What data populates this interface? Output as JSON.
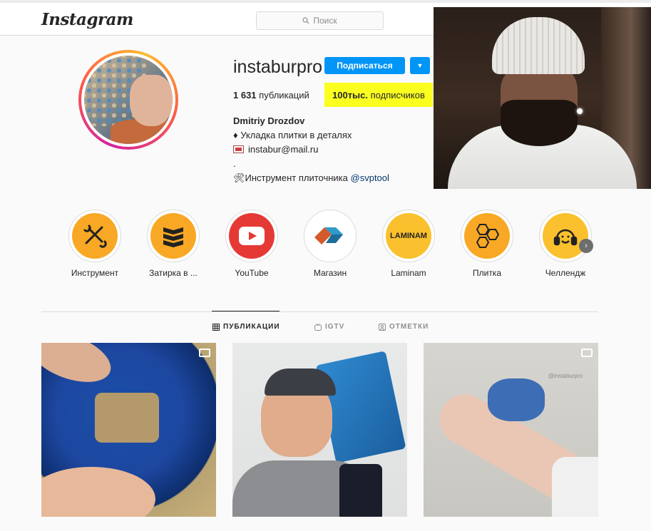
{
  "header": {
    "logo": "Instagram",
    "search_placeholder": "Поиск"
  },
  "profile": {
    "username": "instaburpro",
    "follow_label": "Подписаться",
    "posts_count": "1 631",
    "posts_label": "публикаций",
    "followers_count": "100тыс.",
    "followers_label": "подписчиков",
    "name": "Dmitriy Drozdov",
    "bio_line1": "♦ Укладка плитки в деталях",
    "bio_email": "instabur@mail.ru",
    "bio_dot": ".",
    "bio_tool_prefix": "🛠Инструмент плиточника",
    "bio_tool_link": "@svptool"
  },
  "highlights": [
    {
      "label": "Инструмент",
      "icon": "tools-icon",
      "bg": "#f9a825"
    },
    {
      "label": "Затирка в ...",
      "icon": "grout-layers-icon",
      "bg": "#f9a825"
    },
    {
      "label": "YouTube",
      "icon": "youtube-icon",
      "bg": "#e53935"
    },
    {
      "label": "Магазин",
      "icon": "shop-logo-icon",
      "bg": "#ffffff"
    },
    {
      "label": "Laminam",
      "icon": "laminam-logo-icon",
      "bg": "#fbc02d",
      "text": "LAMINAM"
    },
    {
      "label": "Плитка",
      "icon": "hexagon-tiles-icon",
      "bg": "#f9a825"
    },
    {
      "label": "Челлендж",
      "icon": "headphones-face-icon",
      "bg": "#fbc02d"
    }
  ],
  "tabs": [
    {
      "label": "ПУБЛИКАЦИИ",
      "icon": "grid-icon",
      "active": true
    },
    {
      "label": "IGTV",
      "icon": "igtv-icon",
      "active": false
    },
    {
      "label": "ОТМЕТКИ",
      "icon": "tagged-icon",
      "active": false
    }
  ],
  "posts": [
    {
      "media": "video",
      "icon": "video-icon"
    },
    {
      "media": "image"
    },
    {
      "media": "video",
      "icon": "video-icon",
      "watermark": "@instaburpro"
    }
  ],
  "colors": {
    "accent": "#0095f6",
    "highlight_marker": "#fbff1f",
    "link": "#00376b"
  }
}
